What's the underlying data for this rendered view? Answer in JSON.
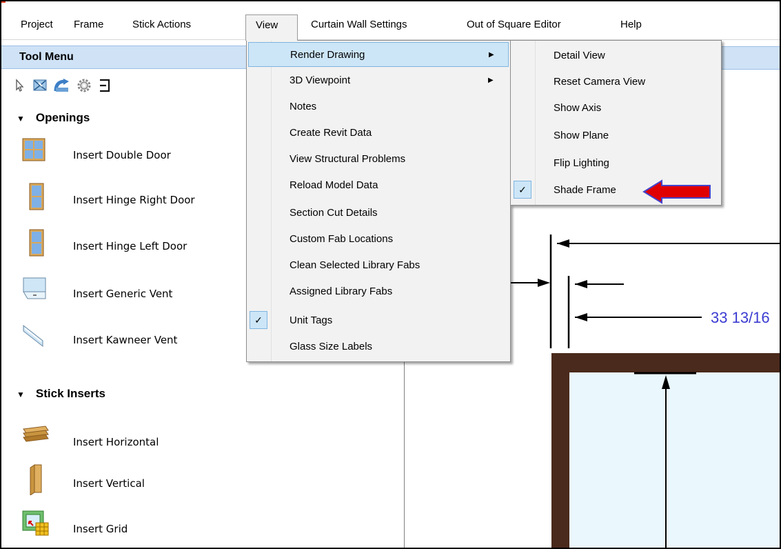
{
  "menubar": {
    "items": [
      "Project",
      "Frame",
      "Stick Actions",
      "View",
      "Curtain Wall Settings",
      "Out of Square Editor",
      "Help"
    ]
  },
  "tool_menu": {
    "title": "Tool Menu",
    "toolbar_icons": [
      "pointer-icon",
      "resize-icon",
      "rotate-icon",
      "gear-icon",
      "bracket-icon"
    ],
    "sections": [
      {
        "title": "Openings",
        "items": [
          "Insert Double Door",
          "Insert Hinge Right Door",
          "Insert Hinge Left Door",
          "Insert Generic Vent",
          "Insert Kawneer Vent"
        ]
      },
      {
        "title": "Stick Inserts",
        "items": [
          "Insert Horizontal",
          "Insert Vertical",
          "Insert Grid"
        ]
      }
    ]
  },
  "view_menu": {
    "items": [
      {
        "label": "Render Drawing",
        "submenu": true,
        "highlighted": true
      },
      {
        "label": "3D Viewpoint",
        "submenu": true
      },
      {
        "label": "Notes"
      },
      {
        "label": "Create Revit Data"
      },
      {
        "label": "View Structural Problems"
      },
      {
        "label": "Reload Model Data"
      },
      {
        "label": "Section Cut Details"
      },
      {
        "label": "Custom Fab Locations"
      },
      {
        "label": "Clean Selected Library Fabs"
      },
      {
        "label": "Assigned Library Fabs"
      },
      {
        "label": "Unit Tags",
        "checked": true
      },
      {
        "label": "Glass Size Labels"
      }
    ]
  },
  "render_submenu": {
    "items": [
      {
        "label": "Detail View"
      },
      {
        "label": "Reset Camera View"
      },
      {
        "label": "Show Axis"
      },
      {
        "label": "Show Plane"
      },
      {
        "label": "Flip Lighting"
      },
      {
        "label": "Shade Frame",
        "checked": true
      }
    ]
  },
  "canvas": {
    "dimension_text": "33 13/16"
  },
  "colors": {
    "highlight": "#cde6f7",
    "panel_header": "#cfe2f6",
    "frame": "#4a2a1c",
    "glass": "#eaf7fc",
    "annotation_arrow": "#e00000",
    "dimension_text": "#3b3bd1"
  }
}
